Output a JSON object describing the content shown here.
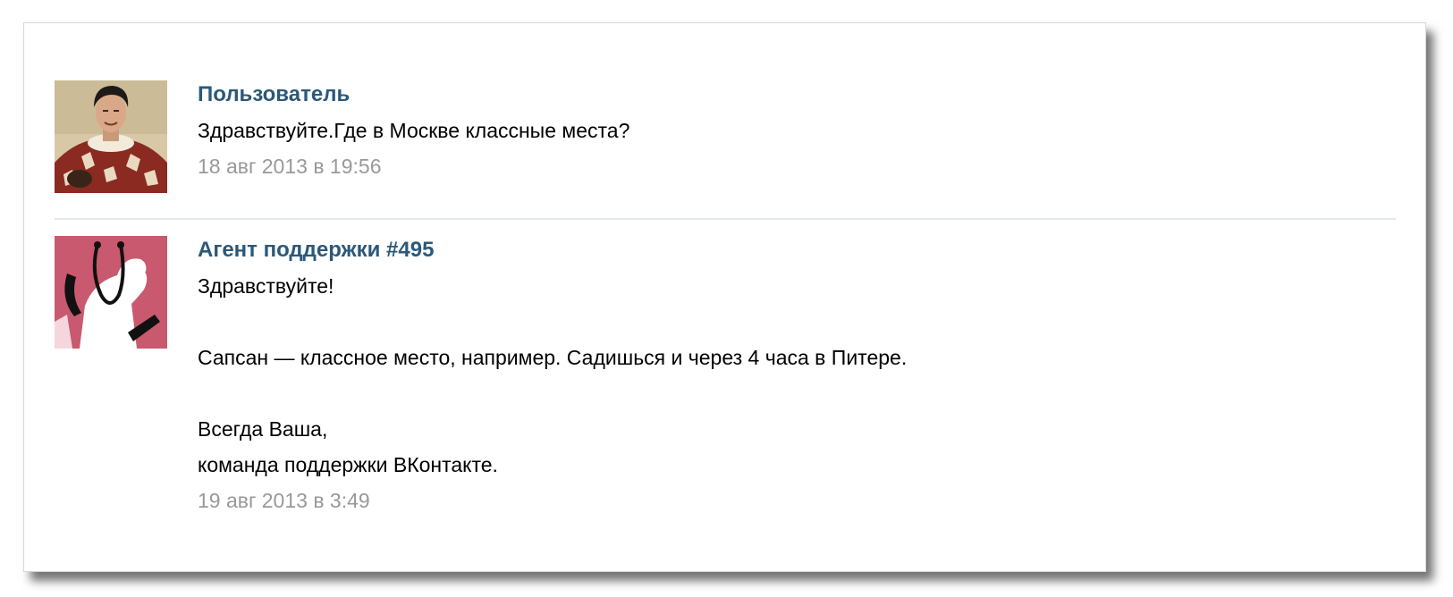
{
  "messages": [
    {
      "author": "Пользователь",
      "text": "Здравствуйте.Где в Москве классные места?",
      "date": "18 авг 2013 в 19:56",
      "avatar_icon": "user-photo-avatar"
    },
    {
      "author": "Агент поддержки #495",
      "text": "Здравствуйте!\n\nСапсан — классное место, например. Садишься и через 4 часа в Питере.\n\nВсегда Ваша,\nкоманда поддержки ВКонтакте.",
      "date": "19 авг 2013 в 3:49",
      "avatar_icon": "support-agent-avatar"
    }
  ],
  "colors": {
    "author_link": "#2b587a",
    "date": "#999999",
    "agent_avatar_bg": "#c9596e"
  }
}
